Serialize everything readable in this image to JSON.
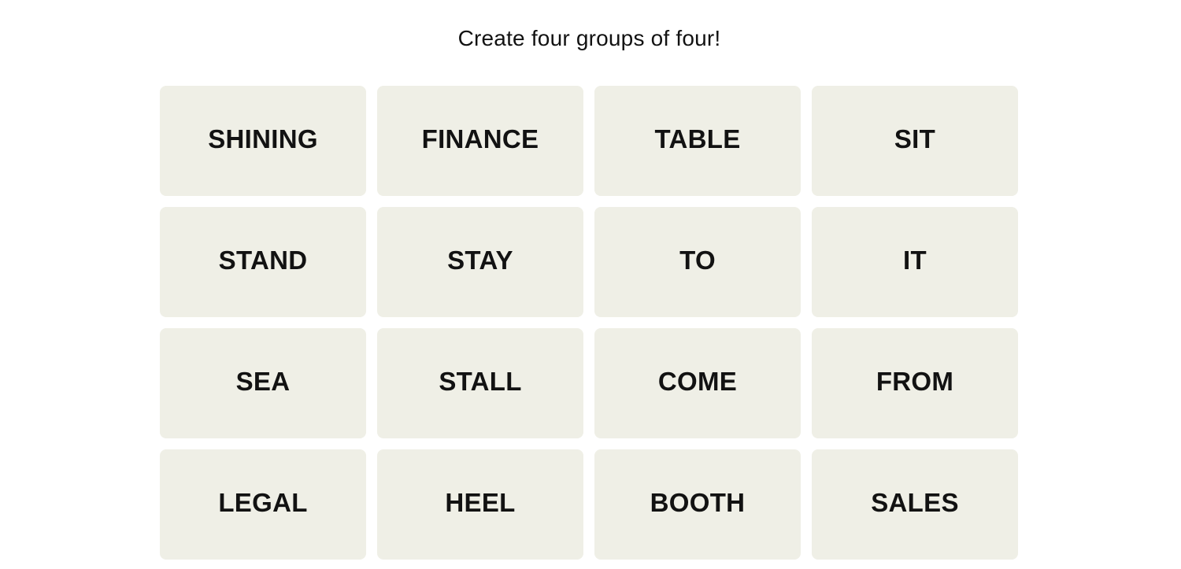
{
  "header": {
    "instructions": "Create four groups of four!"
  },
  "colors": {
    "tile_background": "#efefe6",
    "text": "#121212",
    "page_background": "#ffffff"
  },
  "board": {
    "tiles": [
      {
        "label": "SHINING"
      },
      {
        "label": "FINANCE"
      },
      {
        "label": "TABLE"
      },
      {
        "label": "SIT"
      },
      {
        "label": "STAND"
      },
      {
        "label": "STAY"
      },
      {
        "label": "TO"
      },
      {
        "label": "IT"
      },
      {
        "label": "SEA"
      },
      {
        "label": "STALL"
      },
      {
        "label": "COME"
      },
      {
        "label": "FROM"
      },
      {
        "label": "LEGAL"
      },
      {
        "label": "HEEL"
      },
      {
        "label": "BOOTH"
      },
      {
        "label": "SALES"
      }
    ]
  }
}
